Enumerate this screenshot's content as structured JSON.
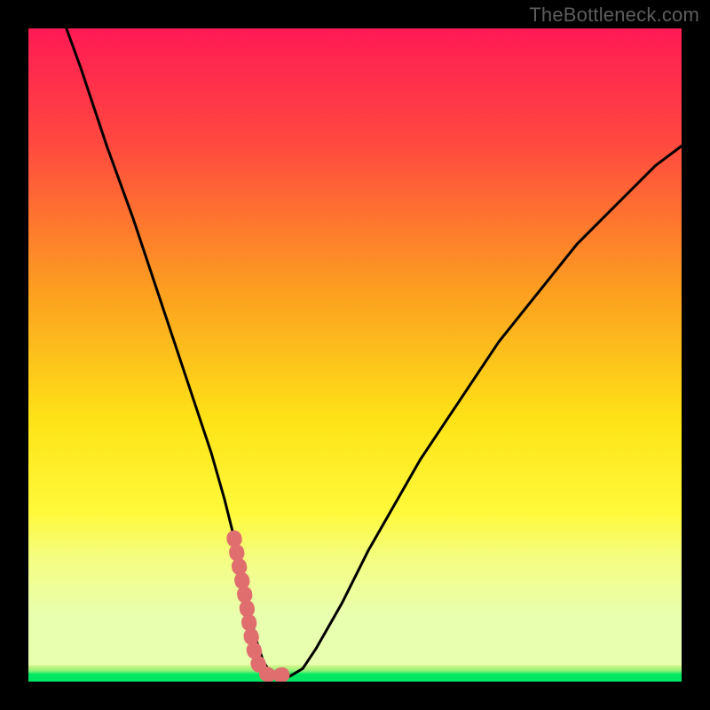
{
  "watermark": "TheBottleneck.com",
  "chart_data": {
    "type": "line",
    "title": "",
    "xlabel": "",
    "ylabel": "",
    "xlim": [
      0,
      100
    ],
    "ylim": [
      0,
      100
    ],
    "grid": false,
    "legend": false,
    "curve": {
      "name": "bottleneck-curve",
      "x": [
        0,
        4,
        8,
        12,
        16,
        20,
        24,
        28,
        30,
        32,
        33,
        34,
        35,
        36,
        37,
        38,
        40,
        42,
        44,
        48,
        52,
        56,
        60,
        64,
        68,
        72,
        76,
        80,
        84,
        88,
        92,
        96,
        100
      ],
      "y": [
        115,
        105,
        94,
        82,
        71,
        59,
        47,
        35,
        28,
        20,
        15,
        10,
        6,
        3,
        1.5,
        0.8,
        0.8,
        2,
        5,
        12,
        20,
        27,
        34,
        40,
        46,
        52,
        57,
        62,
        67,
        71,
        75,
        79,
        82
      ]
    },
    "marked_segment": {
      "name": "highlight",
      "color": "#e06e6e",
      "x": [
        31.5,
        32.2,
        33.0,
        33.5,
        34.0,
        34.5,
        35.0,
        35.5,
        36.0,
        36.8,
        37.6,
        38.4,
        39.2,
        40.0,
        40.5
      ],
      "y": [
        22,
        18,
        14,
        11,
        7.5,
        5,
        3.2,
        2,
        1.4,
        1.0,
        0.9,
        0.95,
        1.1,
        1.3,
        1.6
      ]
    },
    "green_band": {
      "y_from": 0,
      "y_to": 2.5,
      "color_center": "#00e862",
      "color_edge": "#d8f58a"
    },
    "gradient_stops": [
      {
        "offset": 0.0,
        "color": "#ff1a55"
      },
      {
        "offset": 0.18,
        "color": "#ff4a3f"
      },
      {
        "offset": 0.4,
        "color": "#fc9e20"
      },
      {
        "offset": 0.6,
        "color": "#fde317"
      },
      {
        "offset": 0.74,
        "color": "#fff93a"
      },
      {
        "offset": 0.81,
        "color": "#f4fd80"
      },
      {
        "offset": 0.9,
        "color": "#e9ffb0"
      },
      {
        "offset": 1.0,
        "color": "#e9ffb0"
      }
    ]
  }
}
